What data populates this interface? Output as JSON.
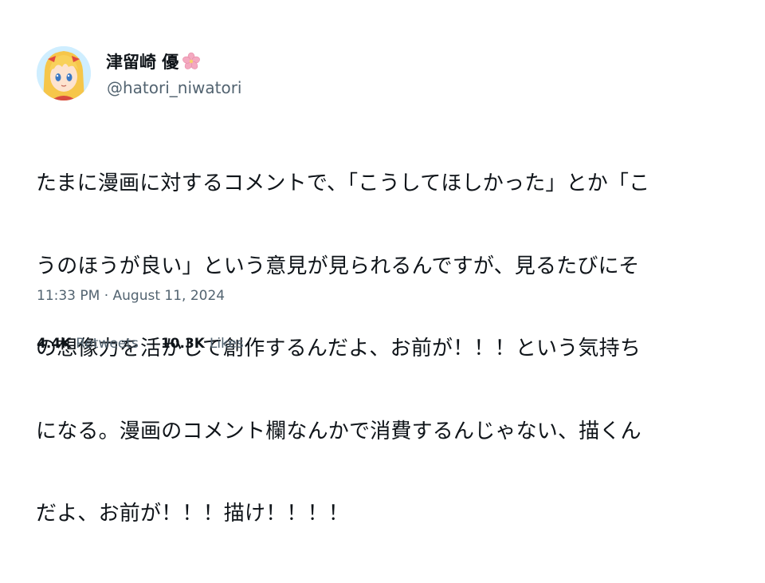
{
  "author": {
    "display_name": "津留崎 優",
    "handle": "@hatori_niwatori",
    "name_emoji_icon": "cherry-blossom-icon",
    "avatar_icon": "anime-girl-avatar"
  },
  "tweet": {
    "lines": [
      "たまに漫画に対するコメントで、「こうしてほしかった」とか「こ",
      "うのほうが良い」という意見が見られるんですが、見るたびにそ",
      "の想像力を活かして創作するんだよ、お前が！！！という気持ち",
      "になる。漫画のコメント欄なんかで消費するんじゃない、描くん",
      "だよ、お前が！！！描け！！！！"
    ],
    "timestamp": "11:33 PM · August 11, 2024"
  },
  "stats": {
    "retweets_count": "4.4K",
    "retweets_label": "Retweets",
    "likes_count": "10.3K",
    "likes_label": "Likes"
  },
  "colors": {
    "text_primary": "#0f1419",
    "text_secondary": "#536471",
    "background": "#ffffff",
    "flower": "#f4a9c0"
  }
}
